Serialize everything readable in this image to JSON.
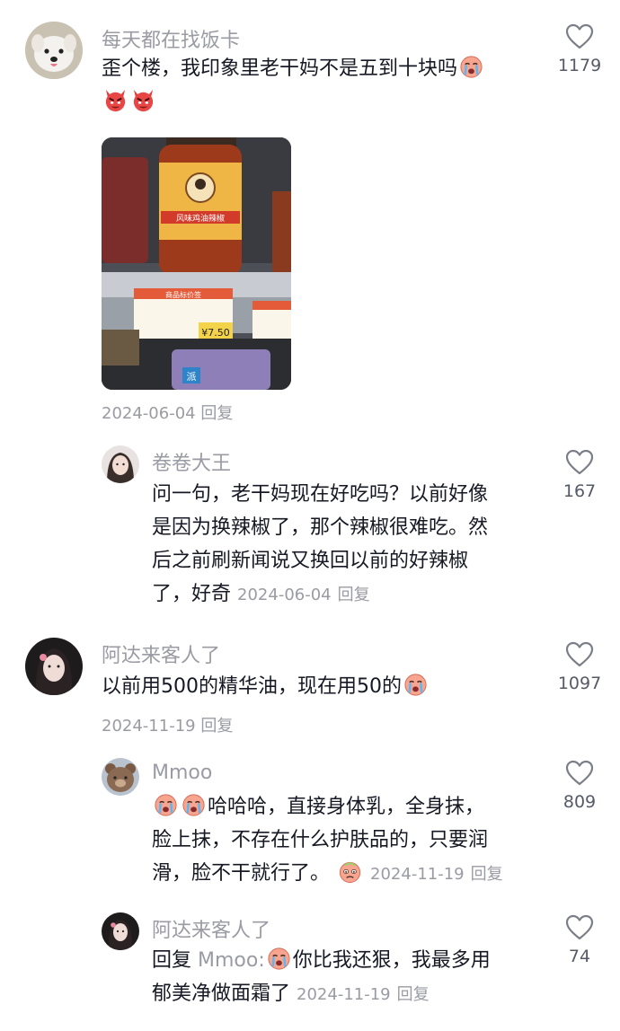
{
  "comments": [
    {
      "user": "每天都在找饭卡",
      "text": "歪个楼，我印象里老干妈不是五到十块吗",
      "date": "2024-06-04",
      "reply_label": "回复",
      "likes": "1179"
    },
    {
      "user": "卷卷大王",
      "lines": [
        "问一句，老干妈现在好吃吗？以前好像",
        "是因为换辣椒了，那个辣椒很难吃。然",
        "后之前刷新闻说又换回以前的好辣椒",
        "了，好奇"
      ],
      "date": "2024-06-04",
      "reply_label": "回复",
      "likes": "167"
    },
    {
      "user": "阿达来客人了",
      "text": "以前用500的精华油，现在用50的",
      "date": "2024-11-19",
      "reply_label": "回复",
      "likes": "1097"
    },
    {
      "user": "Mmoo",
      "lines": [
        "哈哈哈，直接身体乳，全身抹，",
        "脸上抹，不存在什么护肤品的，只要润",
        "滑，脸不干就行了。"
      ],
      "date": "2024-11-19",
      "reply_label": "回复",
      "likes": "809"
    },
    {
      "user": "阿达来客人了",
      "reply_prefix": "回复",
      "mention": "Mmoo:",
      "lines": [
        "你比我还狠，我最多用",
        "郁美净做面霜了"
      ],
      "date": "2024-11-19",
      "reply_label": "回复",
      "likes": "74"
    }
  ],
  "photo": {
    "bottle_label": "风味鸡油辣椒",
    "price": "¥7.50",
    "tag_title": "商品标价签",
    "bag_label": "派"
  },
  "colors": {
    "meta_gray": "#9a9ba3",
    "text": "#161823",
    "like_count": "#555a66"
  },
  "icons": [
    "heart-outline-icon",
    "devil-emoji-icon",
    "crying-emoji-icon",
    "teary-emoji-icon"
  ]
}
